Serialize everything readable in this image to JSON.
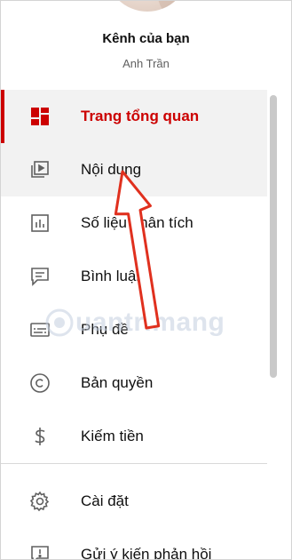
{
  "header": {
    "title": "Kênh của bạn",
    "subtitle": "Anh Trần"
  },
  "nav": {
    "items": [
      {
        "label": "Trang tổng quan",
        "icon": "dashboard-icon",
        "active": true
      },
      {
        "label": "Nội dung",
        "icon": "content-icon",
        "hover": true
      },
      {
        "label": "Số liệu phân tích",
        "icon": "analytics-icon"
      },
      {
        "label": "Bình luận",
        "icon": "comments-icon"
      },
      {
        "label": "Phụ đề",
        "icon": "subtitles-icon"
      },
      {
        "label": "Bản quyền",
        "icon": "copyright-icon"
      },
      {
        "label": "Kiếm tiền",
        "icon": "monetization-icon"
      }
    ]
  },
  "bottom_nav": {
    "items": [
      {
        "label": "Cài đặt",
        "icon": "gear-icon"
      },
      {
        "label": "Gửi ý kiến phản hồi",
        "icon": "feedback-icon"
      }
    ]
  },
  "watermark": {
    "text": "uantrimang"
  },
  "colors": {
    "accent": "#cc0000",
    "icon": "#606060",
    "active_bg": "#f2f2f2"
  }
}
